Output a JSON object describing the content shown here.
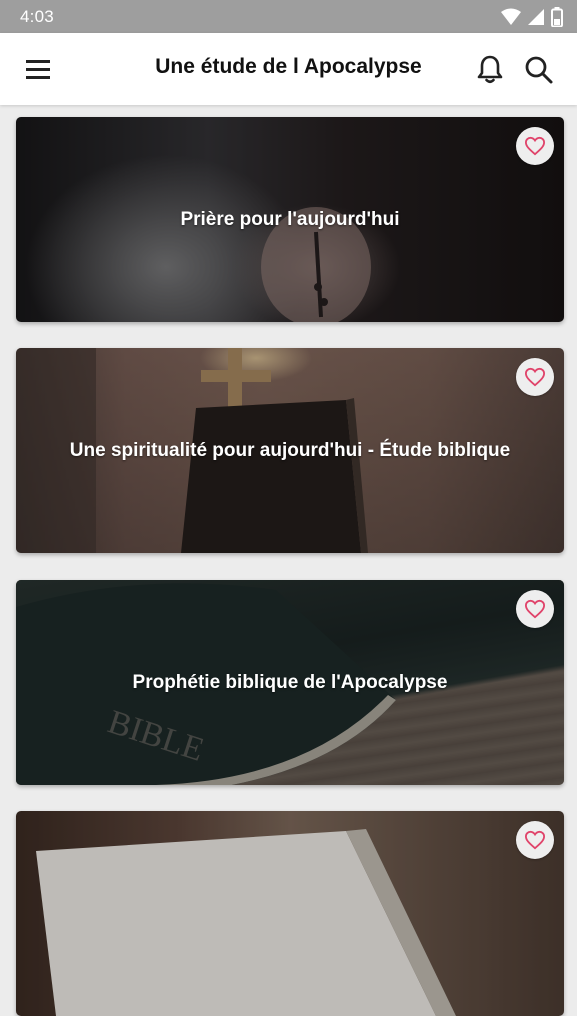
{
  "status_bar": {
    "time": "4:03",
    "icons": [
      "wifi-icon",
      "cellular-signal-icon",
      "battery-icon"
    ]
  },
  "app_bar": {
    "title": "Une étude de l Apocalypse",
    "icons": [
      "menu-icon",
      "bell-icon",
      "search-icon"
    ]
  },
  "cards": [
    {
      "title": "Prière pour l'aujourd'hui",
      "favorite": false
    },
    {
      "title": "Une spiritualité pour aujourd'hui - Étude biblique",
      "favorite": false
    },
    {
      "title": "Prophétie biblique de l'Apocalypse",
      "favorite": false
    },
    {
      "title": "",
      "favorite": false
    }
  ],
  "image_texts": {
    "bible_cover": "BIBLE"
  },
  "colors": {
    "status_bar_bg": "#9e9e9e",
    "app_bar_bg": "#ffffff",
    "heart_outline": "#e0436a",
    "page_bg": "#ececec"
  }
}
